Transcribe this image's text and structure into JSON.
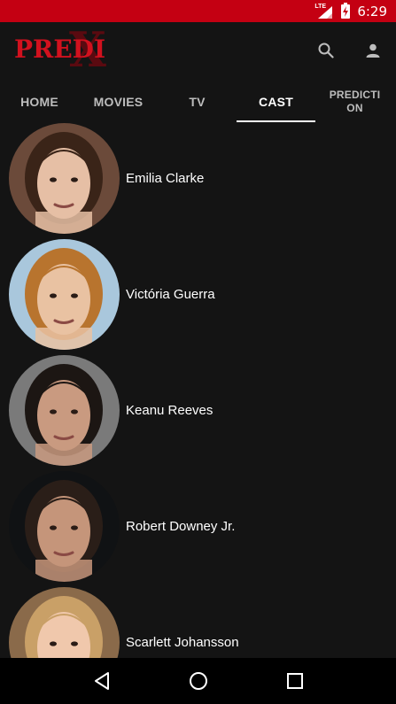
{
  "status_bar": {
    "network": "LTE",
    "time": "6:29"
  },
  "app": {
    "logo_text": "PREDI",
    "logo_mark": "X"
  },
  "tabs": [
    {
      "label": "HOME",
      "active": false
    },
    {
      "label": "MOVIES",
      "active": false
    },
    {
      "label": "TV",
      "active": false
    },
    {
      "label": "CAST",
      "active": true
    },
    {
      "label": "PREDICTI ON",
      "active": false
    }
  ],
  "cast": [
    {
      "name": "Emilia Clarke",
      "bg": "#6b4a3a",
      "skin": "#e6bfa5",
      "hair": "#3a2418"
    },
    {
      "name": "Victória Guerra",
      "bg": "#a9c7dc",
      "skin": "#e9c2a2",
      "hair": "#b8742e"
    },
    {
      "name": "Keanu Reeves",
      "bg": "#7a7a7a",
      "skin": "#c99a80",
      "hair": "#1c1613"
    },
    {
      "name": "Robert Downey Jr.",
      "bg": "#101214",
      "skin": "#c5957a",
      "hair": "#2a1e18"
    },
    {
      "name": "Scarlett Johansson",
      "bg": "#8a6a4a",
      "skin": "#f0c8ac",
      "hair": "#c9a067"
    }
  ],
  "colors": {
    "accent": "#c40012",
    "background": "#141414"
  },
  "icons": {
    "search": "search-icon",
    "account": "account-icon",
    "back": "back-icon",
    "home": "home-icon",
    "recents": "recents-icon"
  }
}
